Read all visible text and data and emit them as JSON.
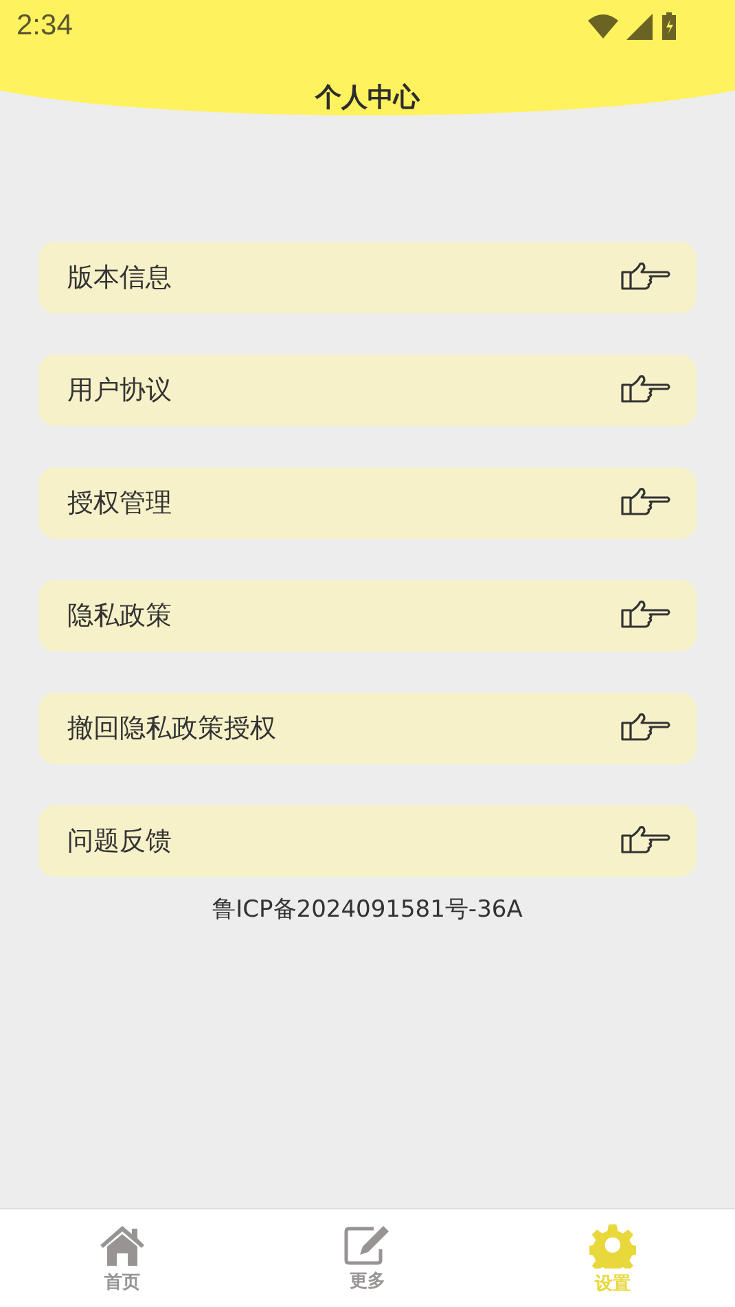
{
  "status_bar": {
    "time": "2:34"
  },
  "title": "个人中心",
  "menu_items": [
    {
      "label": "版本信息"
    },
    {
      "label": "用户协议"
    },
    {
      "label": "授权管理"
    },
    {
      "label": "隐私政策"
    },
    {
      "label": "撤回隐私政策授权"
    },
    {
      "label": "问题反馈"
    }
  ],
  "footer": "鲁ICP备2024091581号-36A",
  "tabs": [
    {
      "label": "首页",
      "kind": "home",
      "selected": false
    },
    {
      "label": "更多",
      "kind": "edit",
      "selected": false
    },
    {
      "label": "设置",
      "kind": "settings",
      "selected": true
    }
  ]
}
